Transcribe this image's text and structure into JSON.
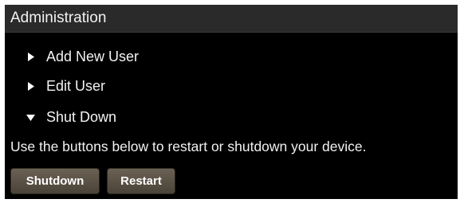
{
  "panel": {
    "title": "Administration"
  },
  "menu": {
    "items": [
      {
        "label": "Add New User",
        "expanded": false,
        "icon": "caret-right-icon"
      },
      {
        "label": "Edit User",
        "expanded": false,
        "icon": "caret-right-icon"
      },
      {
        "label": "Shut Down",
        "expanded": true,
        "icon": "caret-down-icon"
      }
    ]
  },
  "shutdown_section": {
    "description": "Use the buttons below to restart or shutdown your device.",
    "shutdown_label": "Shutdown",
    "restart_label": "Restart"
  },
  "colors": {
    "panel_background": "#000000",
    "header_background": "#2a2a2a",
    "button_background": "#5a5246",
    "text": "#f2f2f2"
  }
}
